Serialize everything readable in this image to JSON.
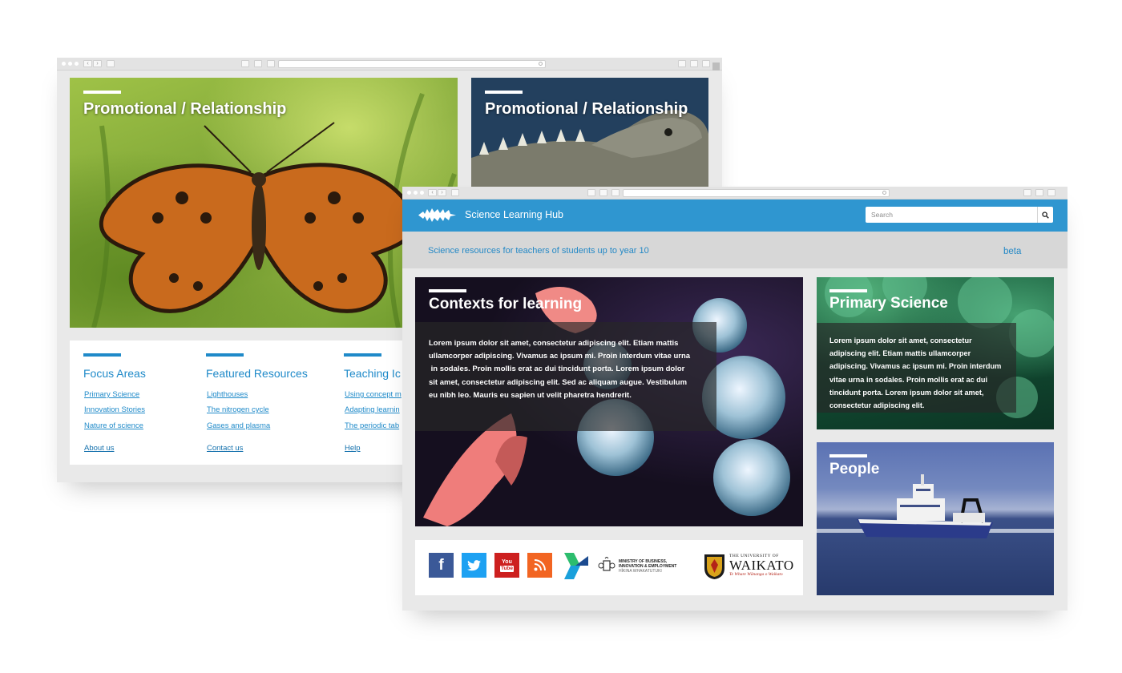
{
  "back_window": {
    "heroes": [
      {
        "title": "Promotional / Relationship"
      },
      {
        "title": "Promotional / Relationship"
      }
    ],
    "footer": {
      "columns": [
        {
          "heading": "Focus Areas",
          "links": [
            "Primary Science",
            "Innovation Stories",
            "Nature of science"
          ],
          "bottom_link": "About us"
        },
        {
          "heading": "Featured Resources",
          "links": [
            "Lighthouses",
            "The nitrogen cycle",
            "Gases and plasma"
          ],
          "bottom_link": "Contact us"
        },
        {
          "heading": "Teaching Ic",
          "links": [
            "Using concept m",
            "Adapting learnin",
            "The periodic tab"
          ],
          "bottom_link": "Help"
        }
      ]
    }
  },
  "front_window": {
    "header": {
      "site_name": "Science Learning Hub",
      "search_placeholder": "Search"
    },
    "subbar": {
      "tagline": "Science resources for teachers of students up to year 10",
      "beta": "beta"
    },
    "cards": {
      "contexts": {
        "title": "Contexts for learning",
        "lines": [
          "Lorem ipsum dolor sit amet, consectetur adipiscing elit. Etiam mattis",
          "ullamcorper adipiscing. Vivamus ac ipsum mi. Proin interdum vitae urna",
          " in sodales. Proin mollis erat ac dui tincidunt porta. Lorem ipsum dolor",
          "sit amet, consectetur adipiscing elit. Sed ac aliquam augue. Vestibulum",
          "eu nibh leo. Mauris eu sapien ut velit pharetra hendrerit."
        ]
      },
      "primary": {
        "title": "Primary Science",
        "lines": [
          "Lorem ipsum dolor sit amet, consectetur",
          "adipiscing elit. Etiam mattis ullamcorper",
          "adipiscing. Vivamus ac ipsum mi. Proin interdum",
          "vitae urna in sodales. Proin mollis erat ac dui",
          "tincidunt porta. Lorem ipsum dolor sit amet,",
          "consectetur adipiscing elit."
        ]
      },
      "people": {
        "title": "People"
      }
    },
    "partners": {
      "social": [
        {
          "icon": "facebook-icon",
          "color": "#3b5998",
          "glyph": "f"
        },
        {
          "icon": "twitter-icon",
          "color": "#1da1f2",
          "glyph": ""
        },
        {
          "icon": "youtube-icon",
          "color": "#cd201f",
          "glyph_top": "You",
          "glyph_bottom": "Tube"
        },
        {
          "icon": "rss-icon",
          "color": "#f26522",
          "glyph": ""
        }
      ],
      "mbie": [
        "MINISTRY OF BUSINESS,",
        "INNOVATION & EMPLOYMENT",
        "HĪKINA WHAKATUTUKI"
      ],
      "waikato": {
        "top": "THE UNIVERSITY OF",
        "name": "WAIKATO",
        "motto": "Te Whare Wānanga o Waikato"
      }
    }
  },
  "colors": {
    "brand_blue": "#2f96d0",
    "link_blue": "#1f8ac9",
    "subbar_grey": "#d7d7d7",
    "page_grey": "#e9e9e9"
  }
}
